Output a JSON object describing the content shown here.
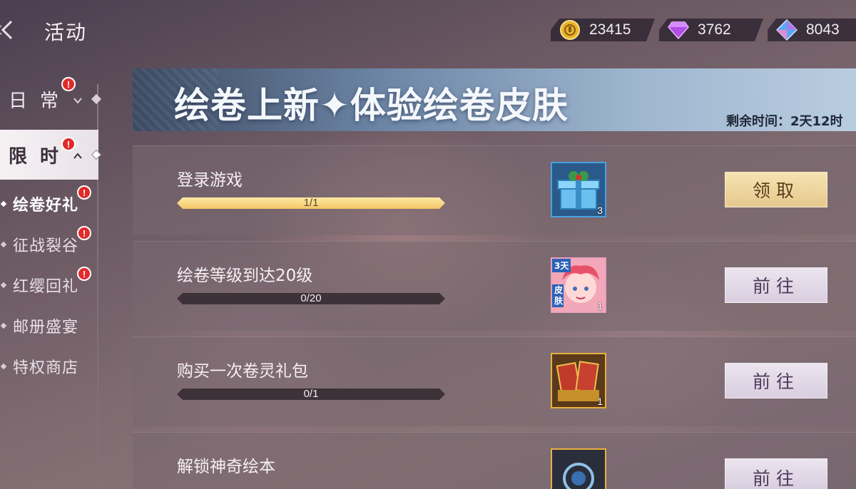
{
  "header": {
    "title": "活动",
    "currencies": [
      {
        "icon": "gold-coin-icon",
        "value": "23415"
      },
      {
        "icon": "purple-diamond-icon",
        "value": "3762"
      },
      {
        "icon": "blue-crystal-icon",
        "value": "8043"
      }
    ]
  },
  "sidebar": {
    "categories": [
      {
        "label": "日常",
        "alert": "!"
      },
      {
        "label": "限时",
        "alert": "!"
      }
    ],
    "items": [
      {
        "label": "绘卷好礼",
        "alert": "!"
      },
      {
        "label": "征战裂谷",
        "alert": "!"
      },
      {
        "label": "红缨回礼",
        "alert": "!"
      },
      {
        "label": "邮册盛宴"
      },
      {
        "label": "特权商店"
      }
    ]
  },
  "banner": {
    "title": "绘卷上新✦体验绘卷皮肤",
    "timer": "剩余时间：2天12时"
  },
  "tasks": [
    {
      "name": "登录游戏",
      "progress": "1/1",
      "progress_fraction": 1.0,
      "reward_icon": "gift-box-icon",
      "reward_count": "3",
      "button": "领取"
    },
    {
      "name": "绘卷等级到达20级",
      "progress": "0/20",
      "progress_fraction": 0.0,
      "reward_icon": "skin-card-icon",
      "reward_tag_top": "3天",
      "reward_tag_side": "皮肤",
      "reward_count": "1",
      "button": "前往"
    },
    {
      "name": "购买一次卷灵礼包",
      "progress": "0/1",
      "progress_fraction": 0.0,
      "reward_icon": "legend-card-pack-icon",
      "reward_count": "1",
      "button": "前往"
    },
    {
      "name": "解锁神奇绘本",
      "reward_icon": "magic-orb-icon",
      "button": "前往"
    }
  ],
  "colors": {
    "alert": "#e22a2a",
    "progress_fill": "#f2c766",
    "claim_button": "#e5c98e",
    "go_button": "#d9cee0",
    "reward_border": "#4aa2e0"
  }
}
